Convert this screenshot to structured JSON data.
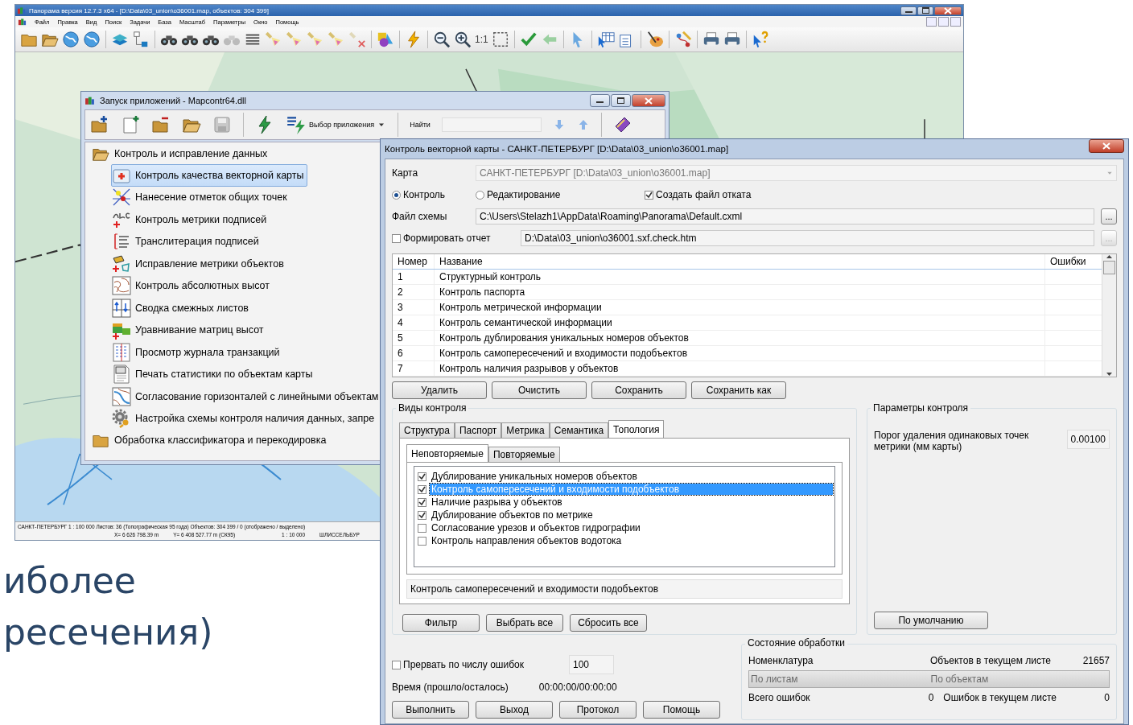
{
  "main_window": {
    "title": "Панорама версия 12.7.3 x64 - [D:\\Data\\03_union\\o36001.map, объектов: 304 399]",
    "menu": [
      "Файл",
      "Правка",
      "Вид",
      "Поиск",
      "Задачи",
      "База",
      "Масштаб",
      "Параметры",
      "Окно",
      "Помощь"
    ],
    "toolbar_text": "1:1",
    "status_bar": {
      "line_1": "САНКТ-ПЕТЕРБУРГ  1 : 100 000  Листов: 36  (Топографическая 95 года)  Объектов: 304 399 / 0 (отображено / выделено)",
      "x": "X= 6 626 798.39 m",
      "y": "Y= 6 408 527.77 m  (СК95)",
      "scale": "1 : 10 000",
      "sheet": "ШЛИССЕЛЬБУР"
    }
  },
  "launcher": {
    "title": "Запуск приложений - Mapcontr64.dll",
    "app_choice": "Выбор приложения",
    "search_label": "Найти",
    "tree": [
      {
        "label": "Контроль и исправление данных",
        "expanded": true,
        "children": [
          {
            "label": "Контроль качества векторной карты",
            "selected": true
          },
          {
            "label": "Нанесение отметок общих точек",
            "selected": false
          },
          {
            "label": "Контроль метрики подписей",
            "selected": false
          },
          {
            "label": "Транслитерация подписей",
            "selected": false
          },
          {
            "label": "Исправление метрики объектов",
            "selected": false
          },
          {
            "label": "Контроль абсолютных высот",
            "selected": false
          },
          {
            "label": "Сводка смежных листов",
            "selected": false
          },
          {
            "label": "Уравнивание матриц высот",
            "selected": false
          },
          {
            "label": "Просмотр журнала транзакций",
            "selected": false
          },
          {
            "label": "Печать статистики по объектам карты",
            "selected": false
          },
          {
            "label": "Согласование горизонталей с линейными объектам",
            "selected": false
          },
          {
            "label": "Настройка схемы контроля наличия данных, запре",
            "selected": false
          }
        ]
      },
      {
        "label": "Обработка классификатора и перекодировка",
        "expanded": false
      }
    ]
  },
  "dialog": {
    "title": "Контроль векторной карты - САНКТ-ПЕТЕРБУРГ [D:\\Data\\03_union\\o36001.map]",
    "map_label": "Карта",
    "map_value": "САНКТ-ПЕТЕРБУРГ [D:\\Data\\03_union\\o36001.map]",
    "modes": [
      {
        "label": "Контроль",
        "selected": true
      },
      {
        "label": "Редактирование",
        "selected": false
      }
    ],
    "rollback": {
      "label": "Создать файл отката",
      "checked": true
    },
    "scheme_label": "Файл схемы",
    "scheme_value": "C:\\Users\\Stelazh1\\AppData\\Roaming\\Panorama\\Default.cxml",
    "browse": "...",
    "report": {
      "label": "Формировать отчет",
      "checked": false,
      "value": "D:\\Data\\03_union\\o36001.sxf.check.htm",
      "browse": "..."
    },
    "table": {
      "columns": [
        "Номер",
        "Название",
        "Ошибки"
      ],
      "rows": [
        {
          "number": "1",
          "name": "Структурный контроль"
        },
        {
          "number": "2",
          "name": "Контроль паспорта"
        },
        {
          "number": "3",
          "name": "Контроль метрической информации"
        },
        {
          "number": "4",
          "name": "Контроль семантической информации"
        },
        {
          "number": "5",
          "name": "Контроль дублирования уникальных номеров объектов"
        },
        {
          "number": "6",
          "name": "Контроль самопересечений и входимости подобъектов"
        },
        {
          "number": "7",
          "name": "Контроль наличия разрывов у объектов"
        }
      ]
    },
    "table_buttons": [
      "Удалить",
      "Очистить",
      "Сохранить",
      "Сохранить как"
    ],
    "kinds": {
      "title": "Виды контроля",
      "tabs": [
        {
          "label": "Структура",
          "selected": false
        },
        {
          "label": "Паспорт",
          "selected": false
        },
        {
          "label": "Метрика",
          "selected": false
        },
        {
          "label": "Семантика",
          "selected": false
        },
        {
          "label": "Топология",
          "selected": true
        }
      ],
      "subtabs": [
        {
          "label": "Неповторяемые",
          "selected": true
        },
        {
          "label": "Повторяемые",
          "selected": false
        }
      ],
      "checks": [
        {
          "label": "Дублирование уникальных номеров объектов",
          "checked": true,
          "selected": false
        },
        {
          "label": "Контроль самопересечений и входимости подобъектов",
          "checked": true,
          "selected": true
        },
        {
          "label": "Наличие разрыва у объектов",
          "checked": true,
          "selected": false
        },
        {
          "label": "Дублирование объектов по метрике",
          "checked": true,
          "selected": false
        },
        {
          "label": "Согласование урезов и объектов гидрографии",
          "checked": false,
          "selected": false
        },
        {
          "label": "Контроль направления объектов водотока",
          "checked": false,
          "selected": false
        }
      ],
      "description": "Контроль самопересечений и входимости подобъектов",
      "buttons": [
        "Фильтр",
        "Выбрать все",
        "Сбросить все"
      ]
    },
    "params": {
      "title": "Параметры контроля",
      "label": "Порог удаления одинаковых точек метрики (мм карты)",
      "value": "0.00100",
      "button": "По умолчанию"
    },
    "stop": {
      "label": "Прервать по числу ошибок",
      "checked": false,
      "value": "100"
    },
    "time_label": "Время (прошло/осталось)",
    "time_value": "00:00:00/00:00:00",
    "buttons": [
      "Выполнить",
      "Выход",
      "Протокол",
      "Помощь"
    ],
    "state": {
      "title": "Состояние обработки",
      "nomenclature": "Номенклатура",
      "objects_label": "Объектов в текущем листе",
      "objects_value": "21657",
      "progress": [
        {
          "label": "По листам",
          "level": 0
        },
        {
          "label": "По объектам",
          "level": 0
        }
      ],
      "total_errors_label": "Всего ошибок",
      "total_errors_value": "0",
      "sheet_errors_label": "Ошибок в текущем листе",
      "sheet_errors_value": "0"
    }
  },
  "slide_text": [
    "иболее",
    "ресечения)"
  ]
}
